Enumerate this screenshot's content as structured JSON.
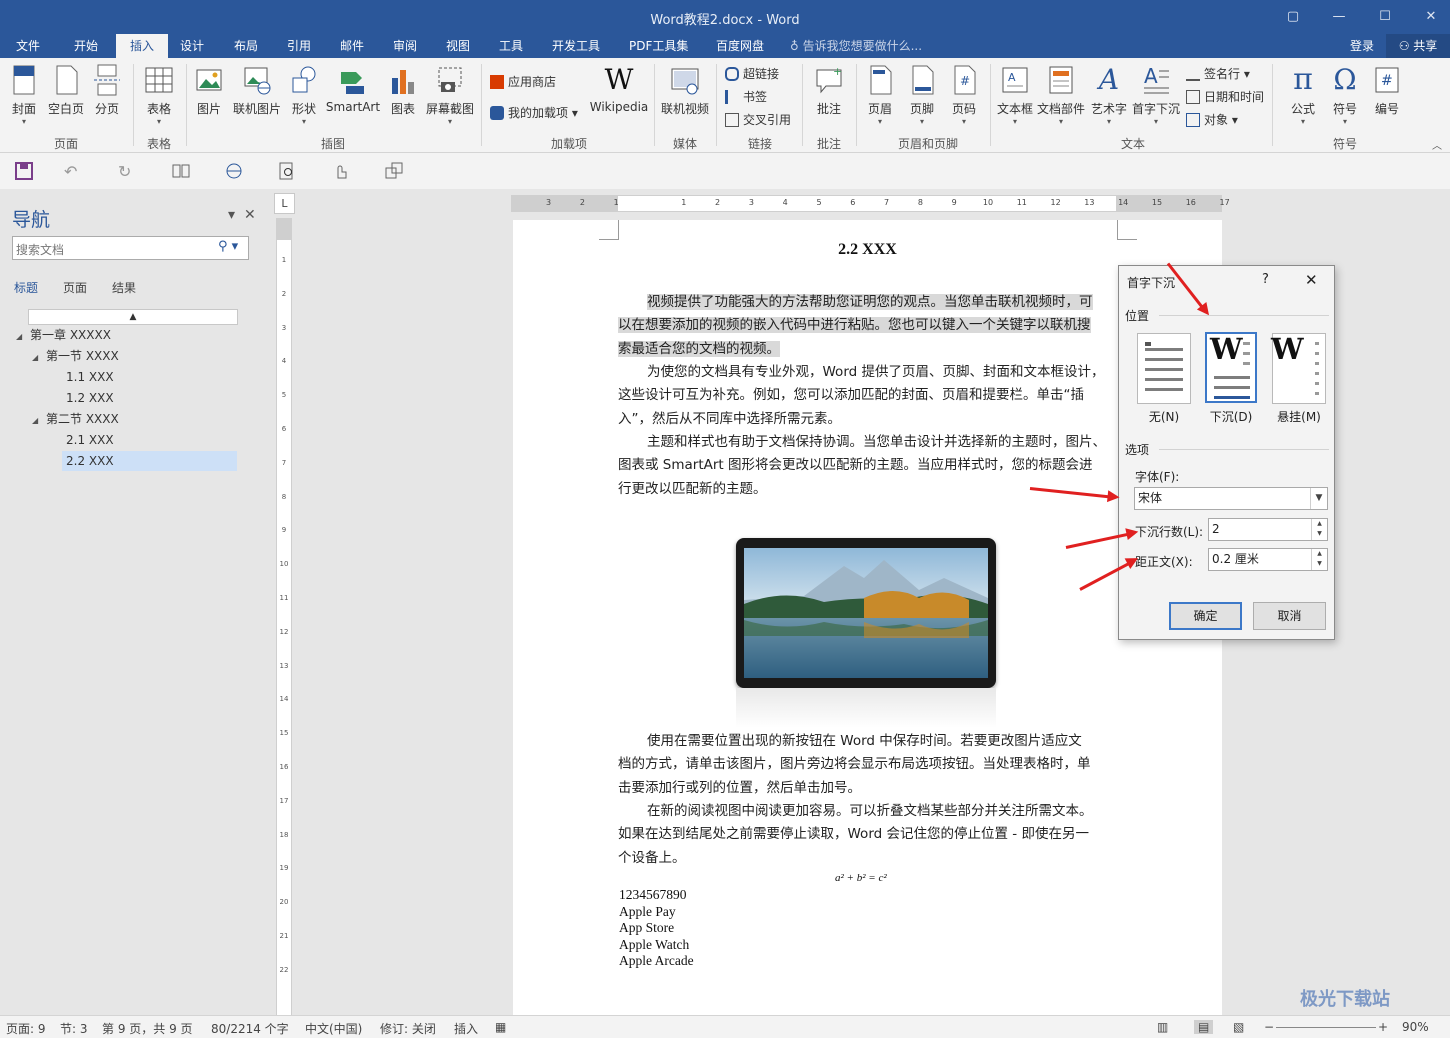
{
  "window": {
    "title": "Word教程2.docx - Word",
    "controls": [
      "▢",
      "—",
      "☐",
      "✕"
    ]
  },
  "ribbon_tabs": [
    "文件",
    "开始",
    "插入",
    "设计",
    "布局",
    "引用",
    "邮件",
    "审阅",
    "视图",
    "工具",
    "开发工具",
    "PDF工具集",
    "百度网盘"
  ],
  "active_tab": "插入",
  "tell_me": "告诉我您想要做什么...",
  "login": "登录",
  "share": "共享",
  "ribbon": {
    "pages": {
      "cover": "封面",
      "blank": "空白页",
      "break": "分页",
      "label": "页面"
    },
    "tables": {
      "table": "表格",
      "label": "表格"
    },
    "illustrations": {
      "picture": "图片",
      "online_picture": "联机图片",
      "shapes": "形状",
      "smartart": "SmartArt",
      "chart": "图表",
      "screenshot": "屏幕截图",
      "label": "插图"
    },
    "addins": {
      "store": "应用商店",
      "my_addins": "我的加载项",
      "wikipedia": "Wikipedia",
      "label": "加载项"
    },
    "media": {
      "video": "联机视频",
      "label": "媒体"
    },
    "links": {
      "hyperlink": "超链接",
      "bookmark": "书签",
      "crossref": "交叉引用",
      "label": "链接"
    },
    "comments": {
      "comment": "批注",
      "label": "批注"
    },
    "header_footer": {
      "header": "页眉",
      "footer": "页脚",
      "page_number": "页码",
      "label": "页眉和页脚"
    },
    "text": {
      "textbox": "文本框",
      "quickparts": "文档部件",
      "wordart": "艺术字",
      "dropcap": "首字下沉",
      "signature": "签名行",
      "datetime": "日期和时间",
      "object": "对象",
      "label": "文本"
    },
    "symbols": {
      "equation": "公式",
      "symbol": "符号",
      "numbering": "编号",
      "label": "符号"
    },
    "wiki_glyph": "W",
    "pi_glyph": "π",
    "omega_glyph": "Ω",
    "hash_glyph": "#"
  },
  "nav": {
    "title": "导航",
    "search_placeholder": "搜索文档",
    "tabs": [
      "标题",
      "页面",
      "结果"
    ],
    "collapse_glyph": "▲",
    "tree": [
      {
        "label": "第一章 XXXXX",
        "level": 0,
        "expanded": true
      },
      {
        "label": "第一节 XXXX",
        "level": 1,
        "expanded": true
      },
      {
        "label": "1.1 XXX",
        "level": 2
      },
      {
        "label": "1.2 XXX",
        "level": 2
      },
      {
        "label": "第二节 XXXX",
        "level": 1,
        "expanded": true
      },
      {
        "label": "2.1 XXX",
        "level": 2
      },
      {
        "label": "2.2 XXX",
        "level": 2,
        "selected": true
      }
    ]
  },
  "ruler": {
    "corner": "L",
    "h_ticks": [
      "3",
      "2",
      "1",
      "1",
      "2",
      "3",
      "4",
      "5",
      "6",
      "7",
      "8",
      "9",
      "10",
      "11",
      "12",
      "13",
      "14",
      "15",
      "16",
      "17"
    ],
    "v_ticks": [
      "1",
      "2",
      "3",
      "4",
      "5",
      "6",
      "7",
      "8",
      "9",
      "10",
      "11",
      "12",
      "13",
      "14",
      "15",
      "16",
      "17",
      "18",
      "19",
      "20",
      "21",
      "22"
    ]
  },
  "document": {
    "heading": "2.2 XXX",
    "p1": [
      "视频提供了功能强大的方法帮助您证明您的观点。当您单击联机视频时，可",
      "以在想要添加的视频的嵌入代码中进行粘贴。您也可以键入一个关键字以联机搜",
      "索最适合您的文档的视频。"
    ],
    "p2": [
      "为使您的文档具有专业外观，Word 提供了页眉、页脚、封面和文本框设计，",
      "这些设计可互为补充。例如，您可以添加匹配的封面、页眉和提要栏。单击“插",
      "入”，然后从不同库中选择所需元素。"
    ],
    "p3": [
      "主题和样式也有助于文档保持协调。当您单击设计并选择新的主题时，图片、",
      "图表或 SmartArt 图形将会更改以匹配新的主题。当应用样式时，您的标题会进",
      "行更改以匹配新的主题。"
    ],
    "p4": [
      "使用在需要位置出现的新按钮在 Word 中保存时间。若要更改图片适应文",
      "档的方式，请单击该图片，图片旁边将会显示布局选项按钮。当处理表格时，单",
      "击要添加行或列的位置，然后单击加号。"
    ],
    "p5": [
      "在新的阅读视图中阅读更加容易。可以折叠文档某些部分并关注所需文本。",
      "如果在达到结尾处之前需要停止读取，Word 会记住您的停止位置 - 即使在另一",
      "个设备上。"
    ],
    "equation": "a² + b² = c²",
    "lines": [
      "1234567890",
      "Apple Pay",
      "App Store",
      "Apple Watch",
      "Apple Arcade"
    ]
  },
  "dialog": {
    "title": "首字下沉",
    "help": "?",
    "close": "✕",
    "position_label": "位置",
    "positions": [
      "无(N)",
      "下沉(D)",
      "悬挂(M)"
    ],
    "selected_position": "下沉(D)",
    "w_glyph": "W",
    "options_label": "选项",
    "font_label": "字体(F):",
    "font_value": "宋体",
    "lines_label": "下沉行数(L):",
    "lines_value": "2",
    "distance_label": "距正文(X):",
    "distance_value": "0.2 厘米",
    "ok": "确定",
    "cancel": "取消"
  },
  "status": {
    "page": "页面: 9",
    "section": "节: 3",
    "page_of": "第 9 页，共 9 页",
    "words": "80/2214 个字",
    "language": "中文(中国)",
    "track": "修订: 关闭",
    "insert": "插入",
    "zoom": "90%"
  },
  "watermark": "极光下载站",
  "colors": {
    "accent": "#2b579a",
    "arrow": "#e02020",
    "highlight": "#d9d9d9",
    "selection": "#cde0f7"
  }
}
